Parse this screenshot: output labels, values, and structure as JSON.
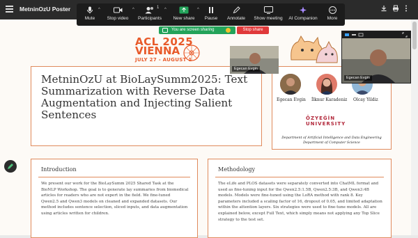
{
  "window": {
    "title": "MetninOzU Poster"
  },
  "zoom_toolbar": {
    "mute": "Mute",
    "stop_video": "Stop video",
    "participants": "Participants",
    "participant_count": "1",
    "new_share": "New share",
    "pause": "Pause",
    "annotate": "Annotate",
    "show_meeting": "Show meeting",
    "ai_companion": "AI Companion",
    "more": "More"
  },
  "share_banner": {
    "status": "You are screen sharing",
    "stop": "Stop share"
  },
  "poster": {
    "conference": {
      "line1": "ACL 2025",
      "line2": "VIENNA",
      "dates": "JULY 27 - AUGUST 1"
    },
    "title": "MetninOzU at BioLaySumm2025: Text Summarization with Reverse Data Augmentation and Injecting Salient Sentences",
    "authors": [
      "Egecan Evgin",
      "İlknur Karadeniz",
      "Olcay Yildiz"
    ],
    "university_line1": "ÖZYEĞİN",
    "university_line2": "UNIVERSITY",
    "dept_line1": "Department of Artificial Intelligence and Data Engineering",
    "dept_line2": "Department of Computer Science",
    "introduction": {
      "heading": "Introduction",
      "body": "We present our work for the BioLaySumm 2025 Shared Task at the BioNLP Workshop. The goal is to generate lay summaries from biomedical articles for readers who are not expert in the field. We fine-tuned Qwen2.5 and Qwen3 models on cleaned and expanded datasets. Our method includes sentence selection, sliced inputs, and data augmentation using articles written for children."
    },
    "methodology": {
      "heading": "Methodology",
      "body": "The eLife and PLOS datasets were separately converted into ChatML format and used as fine-tuning input for the Qwen2.5:1.5B, Qwen2.5:3B, and Qwen3:4B models. Models were fine-tuned using the LoRA method with rank 8. Key parameters included a scaling factor of 16, dropout of 0.05, and limited adaptation within the attention layers. Six strategies were used to fine-tune models. All are explained below, except Full Text, which simply means not applying any Top Slice strategy to the test set."
    }
  },
  "video_tiles": {
    "small_name": "Egecan Evgin",
    "large_name": "Egecan Evgin"
  },
  "colors": {
    "accent": "#e08a5c",
    "zoom_green": "#23a35a",
    "stop_red": "#e0393a",
    "university": "#b2283b"
  }
}
